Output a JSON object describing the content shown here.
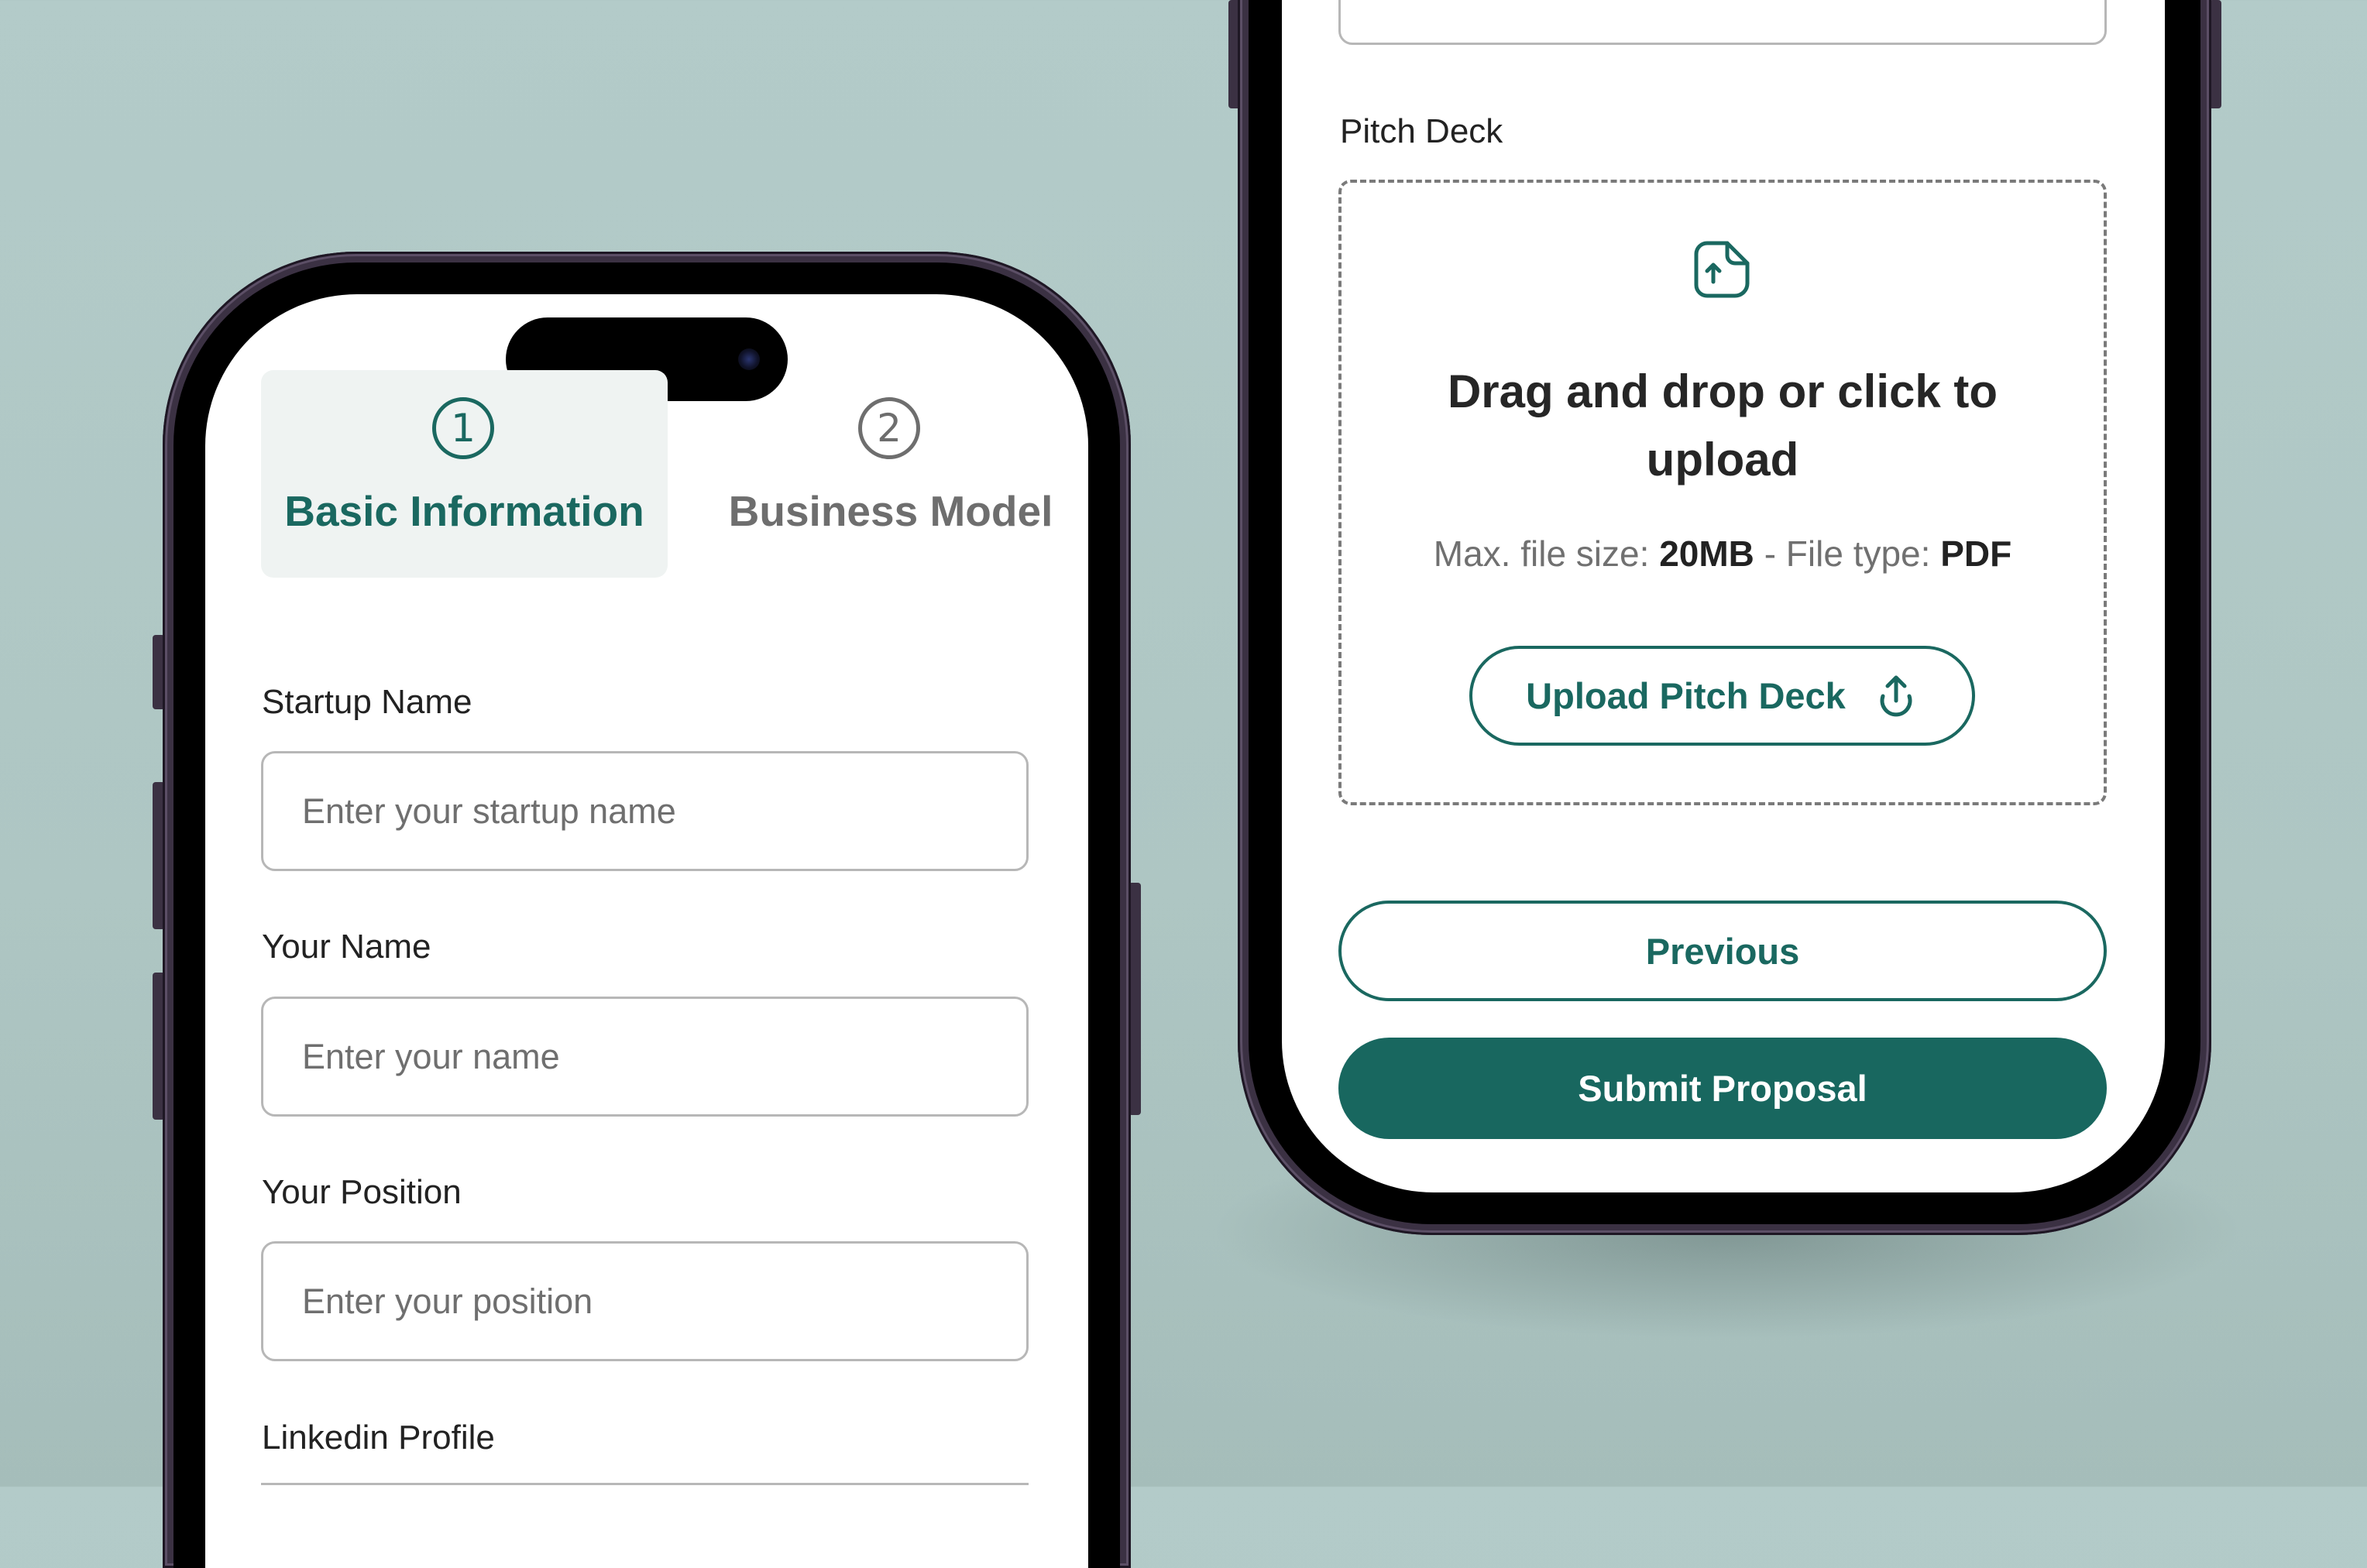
{
  "left_screen": {
    "stepper": {
      "steps": [
        {
          "number": "1",
          "label": "Basic Information",
          "state": "active"
        },
        {
          "number": "2",
          "label": "Business Model",
          "state": "inactive"
        }
      ]
    },
    "form": {
      "fields": [
        {
          "label": "Startup Name",
          "placeholder": "Enter your startup name",
          "value": ""
        },
        {
          "label": "Your Name",
          "placeholder": "Enter your name",
          "value": ""
        },
        {
          "label": "Your Position",
          "placeholder": "Enter your position",
          "value": ""
        },
        {
          "label": "Linkedin Profile"
        }
      ]
    }
  },
  "right_screen": {
    "pitch_deck": {
      "label": "Pitch Deck",
      "icon": "file-upload-icon",
      "heading_line1": "Drag and drop or click to",
      "heading_line2": "upload",
      "max_size_label": "Max. file size:",
      "max_size_value": "20MB",
      "separator": "-",
      "file_type_label": "File type:",
      "file_type_value": "PDF",
      "upload_button": "Upload Pitch Deck",
      "upload_icon": "upload-arrow-icon"
    },
    "actions": {
      "previous": "Previous",
      "submit": "Submit Proposal"
    }
  },
  "colors": {
    "brand": "#18675f",
    "inactive": "#6e6e6e",
    "background": "#b3cbc9",
    "tab_active_bg": "#eff3f2"
  }
}
